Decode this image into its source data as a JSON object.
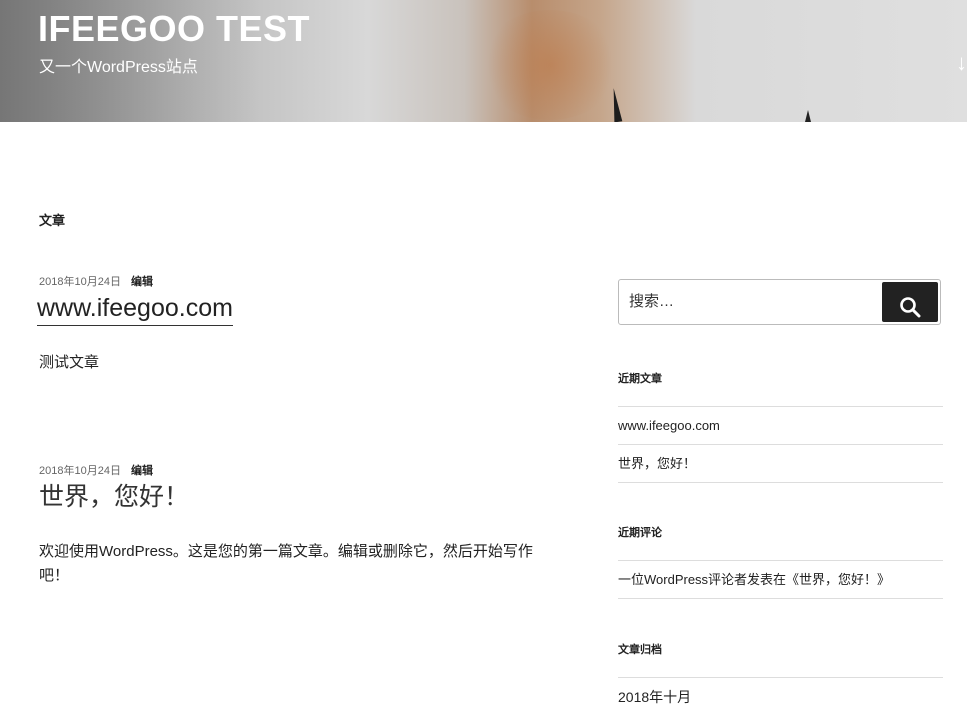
{
  "site": {
    "title": "IFEEGOO TEST",
    "description": "又一个WordPress站点",
    "scroll_icon": "arrow-down-icon"
  },
  "page": {
    "title": "文章"
  },
  "posts": [
    {
      "date": "2018年10月24日",
      "edit_label": "编辑",
      "title": "www.ifeegoo.com",
      "body": "测试文章"
    },
    {
      "date": "2018年10月24日",
      "edit_label": "编辑",
      "title": "世界，您好！",
      "body": "欢迎使用WordPress。这是您的第一篇文章。编辑或删除它，然后开始写作吧！"
    }
  ],
  "sidebar": {
    "search": {
      "placeholder": "搜索…",
      "button_icon": "search-icon"
    },
    "recent_posts": {
      "title": "近期文章",
      "items": [
        "www.ifeegoo.com",
        "世界，您好！"
      ]
    },
    "recent_comments": {
      "title": "近期评论",
      "items": [
        "一位WordPress评论者发表在《世界，您好！》"
      ]
    },
    "archives": {
      "title": "文章归档",
      "items": [
        "2018年十月"
      ]
    }
  },
  "colors": {
    "button_bg": "#222222",
    "text": "#222222",
    "header_text": "#ffffff"
  }
}
